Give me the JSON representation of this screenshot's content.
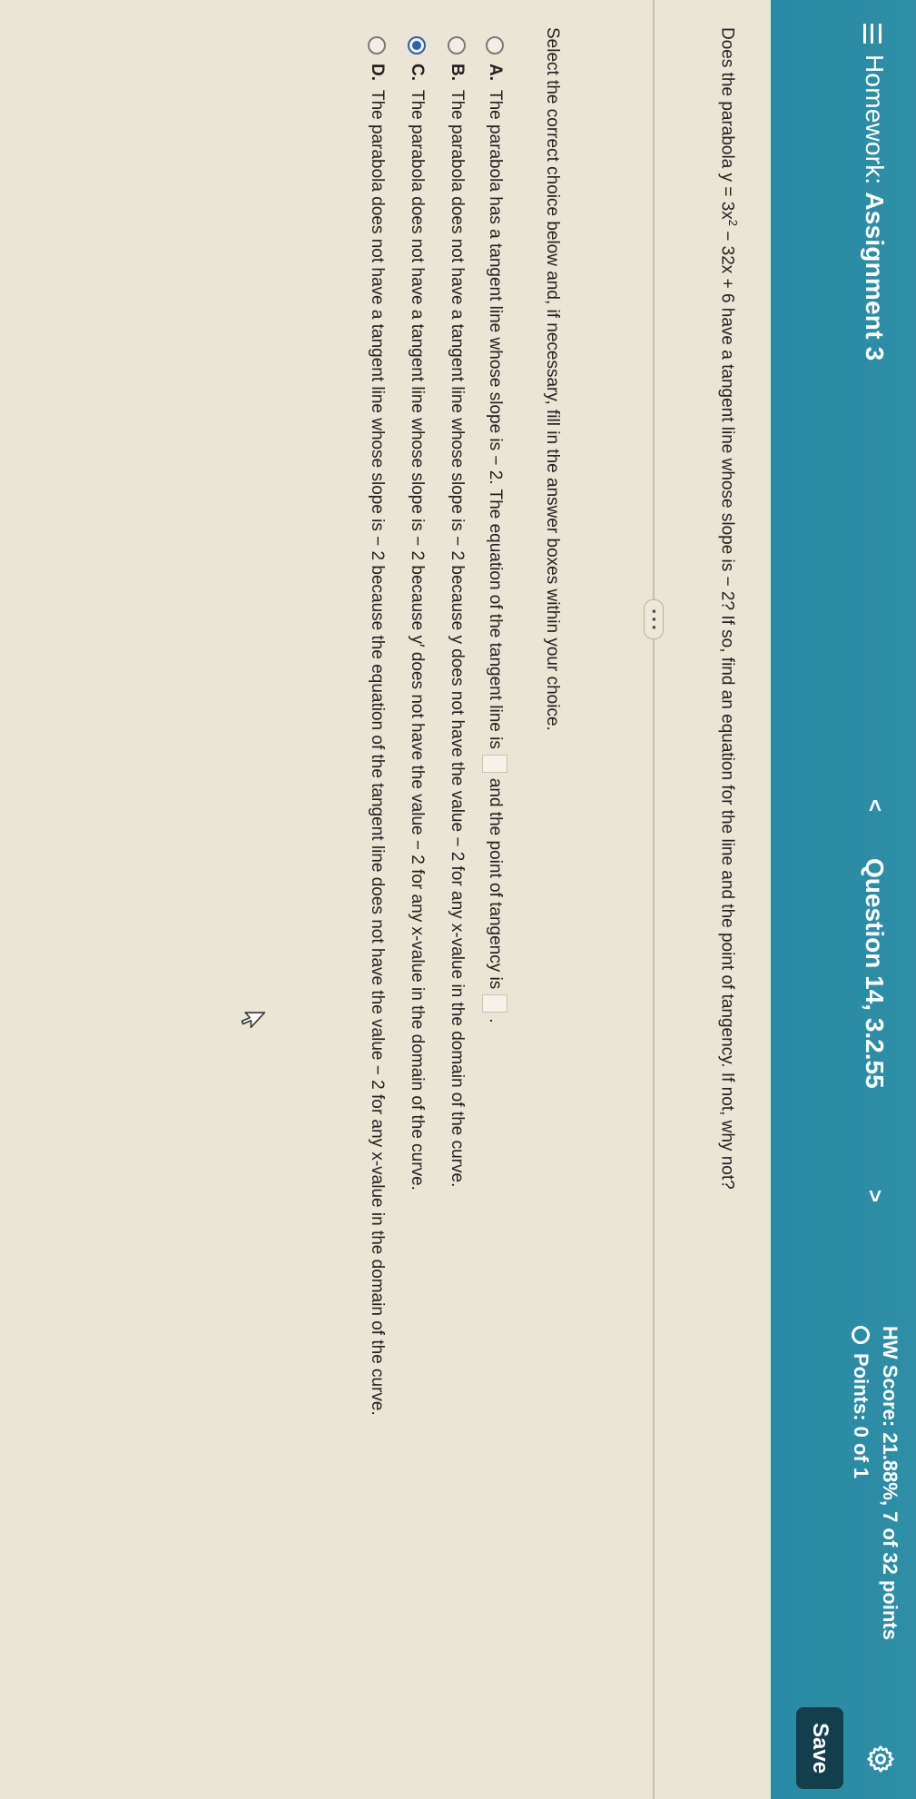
{
  "header": {
    "homework_prefix": "Homework:",
    "assignment": "Assignment 3",
    "question": "Question 14, 3.2.55",
    "prev_symbol": "<",
    "next_symbol": ">",
    "score": "HW Score: 21.88%, 7 of 32 points",
    "points": "Points: 0 of 1",
    "save_label": "Save"
  },
  "question": {
    "prefix": "Does the parabola y = 3x",
    "exponent": "2",
    "suffix": " − 32x + 6 have a tangent line whose slope is  − 2? If so, find an equation for the line and the point of tangency. If not, why not?"
  },
  "more_label": "• • •",
  "instruction": "Select the correct choice below and, if necessary, fill in the answer boxes within your choice.",
  "choices": [
    {
      "letter": "A.",
      "text_a": "The parabola has a tangent line whose slope is  − 2. The equation of the tangent line is",
      "text_b": "and the point of tangency is",
      "text_c": ".",
      "selected": false
    },
    {
      "letter": "B.",
      "text": "The parabola does not have a tangent line whose slope is  − 2 because y does not have the value  − 2 for any x-value in the domain of the curve.",
      "selected": false
    },
    {
      "letter": "C.",
      "text": "The parabola does not have a tangent line whose slope is  − 2 because y′ does not have the value  − 2 for any x-value in the domain of the curve.",
      "selected": true
    },
    {
      "letter": "D.",
      "text": "The parabola does not have a tangent line whose slope is  − 2 because the equation of the tangent line does not have the value  − 2 for any x-value in the domain of the curve.",
      "selected": false
    }
  ],
  "icons": [
    "menu-icon",
    "chevron-left-icon",
    "chevron-right-icon",
    "points-circle-icon",
    "gear-icon",
    "mouse-cursor-icon"
  ]
}
